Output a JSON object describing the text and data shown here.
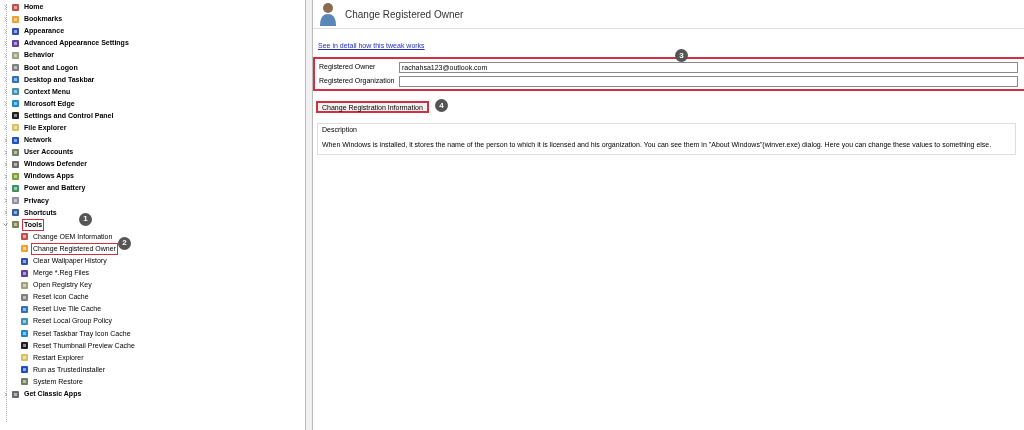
{
  "tree": [
    {
      "label": "Home",
      "expanded": false,
      "highlighted": false
    },
    {
      "label": "Bookmarks",
      "expanded": false,
      "highlighted": false
    },
    {
      "label": "Appearance",
      "expanded": false,
      "highlighted": false
    },
    {
      "label": "Advanced Appearance Settings",
      "expanded": false,
      "highlighted": false
    },
    {
      "label": "Behavior",
      "expanded": false,
      "highlighted": false
    },
    {
      "label": "Boot and Logon",
      "expanded": false,
      "highlighted": false
    },
    {
      "label": "Desktop and Taskbar",
      "expanded": false,
      "highlighted": false
    },
    {
      "label": "Context Menu",
      "expanded": false,
      "highlighted": false
    },
    {
      "label": "Microsoft Edge",
      "expanded": false,
      "highlighted": false
    },
    {
      "label": "Settings and Control Panel",
      "expanded": false,
      "highlighted": false
    },
    {
      "label": "File Explorer",
      "expanded": false,
      "highlighted": false
    },
    {
      "label": "Network",
      "expanded": false,
      "highlighted": false
    },
    {
      "label": "User Accounts",
      "expanded": false,
      "highlighted": false
    },
    {
      "label": "Windows Defender",
      "expanded": false,
      "highlighted": false
    },
    {
      "label": "Windows Apps",
      "expanded": false,
      "highlighted": false
    },
    {
      "label": "Power and Battery",
      "expanded": false,
      "highlighted": false
    },
    {
      "label": "Privacy",
      "expanded": false,
      "highlighted": false
    },
    {
      "label": "Shortcuts",
      "expanded": false,
      "highlighted": false
    },
    {
      "label": "Tools",
      "expanded": true,
      "highlighted": true,
      "badge": "1",
      "children": [
        {
          "label": "Change OEM Information",
          "highlighted": false
        },
        {
          "label": "Change Registered Owner",
          "highlighted": true,
          "badge": "2"
        },
        {
          "label": "Clear Wallpaper History",
          "highlighted": false
        },
        {
          "label": "Merge *.Reg Files",
          "highlighted": false
        },
        {
          "label": "Open Registry Key",
          "highlighted": false
        },
        {
          "label": "Reset Icon Cache",
          "highlighted": false
        },
        {
          "label": "Reset Live Tile Cache",
          "highlighted": false
        },
        {
          "label": "Reset Local Group Policy",
          "highlighted": false
        },
        {
          "label": "Reset Taskbar Tray Icon Cache",
          "highlighted": false
        },
        {
          "label": "Reset Thumbnail Preview Cache",
          "highlighted": false
        },
        {
          "label": "Restart Explorer",
          "highlighted": false
        },
        {
          "label": "Run as TrustedInstaller",
          "highlighted": false
        },
        {
          "label": "System Restore",
          "highlighted": false
        }
      ]
    },
    {
      "label": "Get Classic Apps",
      "expanded": false,
      "highlighted": false
    }
  ],
  "panel": {
    "title": "Change Registered Owner",
    "link": "See in detail how this tweak works",
    "fields_highlighted": true,
    "fields_badge": "3",
    "fields": [
      {
        "label": "Registered Owner",
        "value": "rachahsa123@outlook.com"
      },
      {
        "label": "Registered Organization"
      }
    ],
    "button": {
      "label": "Change Registration Information",
      "highlighted": true,
      "badge": "4"
    },
    "description": {
      "legend": "Description",
      "text": "When Windows is installed, it stores the name of the person to which it is licensed and his organization. You can see them in \"About Windows\"(winver.exe) dialog. Here you can change these values to something else."
    }
  }
}
